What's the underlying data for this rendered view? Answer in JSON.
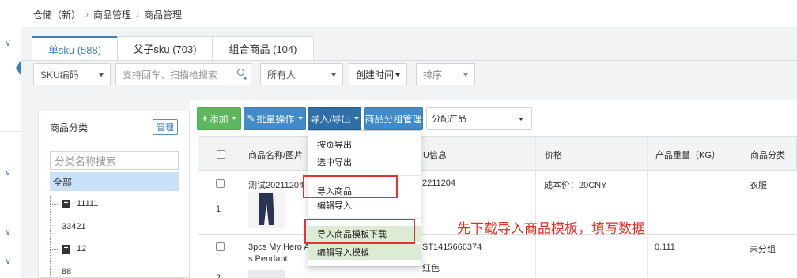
{
  "breadcrumb": [
    "仓储（新）",
    "商品管理",
    "商品管理"
  ],
  "tabs": [
    {
      "label": "单sku (588)",
      "active": true
    },
    {
      "label": "父子sku (703)",
      "active": false
    },
    {
      "label": "组合商品 (104)",
      "active": false
    }
  ],
  "filters": {
    "sku_code": "SKU编码",
    "search_placeholder": "支持回车、扫描枪搜索",
    "owner": "所有人",
    "created_time": "创建时间",
    "sort": "排序"
  },
  "category_panel": {
    "title": "商品分类",
    "manage_label": "管理",
    "search_placeholder": "分类名称搜索",
    "all_label": "全部",
    "nodes": [
      {
        "label": "11111",
        "expandable": true
      },
      {
        "label": "33421",
        "expandable": false
      },
      {
        "label": "12",
        "expandable": true
      },
      {
        "label": "88",
        "expandable": false
      }
    ]
  },
  "toolbar": {
    "add": "添加",
    "batch": "批量操作",
    "import_export": "导入/导出",
    "group_manage": "商品分组管理",
    "assign": "分配产品"
  },
  "table": {
    "headers": [
      "商品名称/图片",
      "SKU信息",
      "价格",
      "产品重量（KG）",
      "商品分类"
    ],
    "sku_header_visible": "U信息",
    "rows": [
      {
        "index": "1",
        "name": "测试20211204",
        "sku": "2211204",
        "price": "成本价：20CNY",
        "weight": "",
        "category": "衣服"
      },
      {
        "index": "2",
        "name_line1": "3pcs My Hero A",
        "name_line2": "s Pendant",
        "sku": "ST1415666374",
        "sku_line2": "红色",
        "price": "",
        "weight": "0.111",
        "category": "未分组"
      }
    ]
  },
  "import_menu": {
    "items": [
      "按页导出",
      "选中导出",
      "导入商品",
      "编辑导入",
      "导入商品模板下载",
      "编辑导入模板"
    ]
  },
  "annotation": "先下载导入商品模板，填写数据",
  "colors": {
    "accent": "#3d7fc1",
    "green": "#5cb85c",
    "red": "#e5322d",
    "selected": "#c9e2f7"
  }
}
